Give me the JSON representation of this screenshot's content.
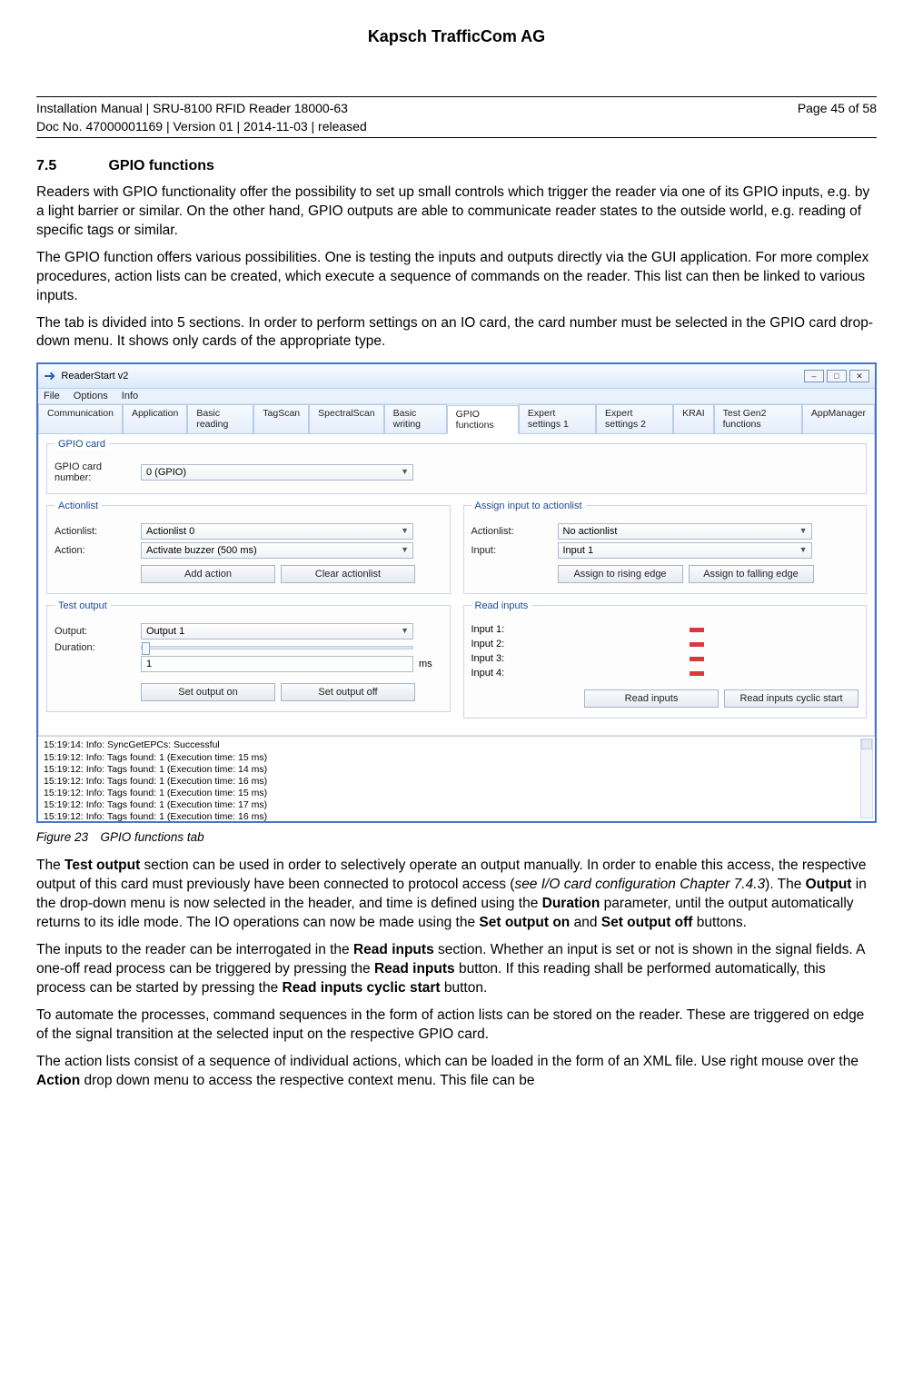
{
  "company": "Kapsch TrafficCom AG",
  "docline1_left": "Installation Manual | SRU-8100 RFID Reader 18000-63",
  "docline1_right": "Page 45 of 58",
  "docline2_left": "Doc No. 47000001169 | Version 01 | 2014-11-03 | released",
  "section": {
    "num": "7.5",
    "title": "GPIO functions"
  },
  "para1": "Readers with GPIO functionality offer the possibility to set up small controls which trigger the reader via one of its GPIO inputs, e.g. by a light barrier or similar. On the other hand, GPIO outputs are able to communicate reader states to the outside world, e.g. reading of specific tags or similar.",
  "para2": "The GPIO function offers various possibilities. One is testing the inputs and outputs directly via the GUI application. For more complex procedures, action lists can be created, which execute a sequence of commands on the reader. This list can then be linked to various inputs.",
  "para3": "The tab is divided into 5 sections. In order to perform settings on an IO card, the card number must be selected in the GPIO card drop-down menu. It shows only cards of the appropriate type.",
  "caption": "Figure 23 GPIO functions tab",
  "para4_pre": "The ",
  "para4_b1": "Test output",
  "para4_mid1": " section can be used in order to selectively operate an output manually. In order to enable this access, the respective output of this card must previously have been connected to protocol access (",
  "para4_i": "see I/O card configuration Chapter 7.4.3",
  "para4_mid2": "). The ",
  "para4_b2": "Output",
  "para4_mid3": " in the drop-down menu is now selected in the header, and time is defined using the ",
  "para4_b3": "Duration",
  "para4_mid4": " parameter, until the output automatically returns to its idle mode. The IO operations can now be made using the ",
  "para4_b4": "Set output on",
  "para4_mid5": " and ",
  "para4_b5": "Set output off",
  "para4_end": " buttons.",
  "para5_pre": "The inputs to the reader can be interrogated in the ",
  "para5_b1": "Read inputs",
  "para5_mid1": " section. Whether an input is set or not is shown in the signal fields. A one-off read process can be triggered by pressing the ",
  "para5_b2": "Read inputs",
  "para5_mid2": " button. If this reading shall be performed automatically, this process can be started by pressing the ",
  "para5_b3": "Read inputs cyclic start",
  "para5_end": " button.",
  "para6": "To automate the processes, command sequences in the form of action lists can be stored on the reader. These are triggered on edge of the signal transition at the selected input on the respective GPIO card.",
  "para7_pre": "The action lists consist of a sequence of individual actions, which can be loaded in the form of an XML file. Use right mouse over the ",
  "para7_b": "Action",
  "para7_end": " drop down menu to access the respective context menu.  This file can be",
  "win": {
    "title": "ReaderStart v2",
    "menu": {
      "file": "File",
      "options": "Options",
      "info": "Info"
    },
    "tabs": [
      "Communication",
      "Application",
      "Basic reading",
      "TagScan",
      "SpectralScan",
      "Basic writing",
      "GPIO functions",
      "Expert settings 1",
      "Expert settings 2",
      "KRAI",
      "Test Gen2 functions",
      "AppManager"
    ],
    "gpio_card": {
      "legend": "GPIO card",
      "label": "GPIO card number:",
      "value": "0 (GPIO)"
    },
    "actionlist": {
      "legend": "Actionlist",
      "list_label": "Actionlist:",
      "list_value": "Actionlist 0",
      "action_label": "Action:",
      "action_value": "Activate buzzer (500 ms)",
      "btn_add": "Add action",
      "btn_clear": "Clear actionlist"
    },
    "assign": {
      "legend": "Assign input to actionlist",
      "list_label": "Actionlist:",
      "list_value": "No actionlist",
      "input_label": "Input:",
      "input_value": "Input 1",
      "btn_rise": "Assign to rising edge",
      "btn_fall": "Assign to falling edge"
    },
    "testout": {
      "legend": "Test output",
      "out_label": "Output:",
      "out_value": "Output 1",
      "dur_label": "Duration:",
      "dur_num": "1",
      "ms": "ms",
      "btn_on": "Set output on",
      "btn_off": "Set output off"
    },
    "readin": {
      "legend": "Read inputs",
      "in1": "Input 1:",
      "in2": "Input 2:",
      "in3": "Input 3:",
      "in4": "Input 4:",
      "btn_read": "Read inputs",
      "btn_cyclic": "Read inputs cyclic start"
    },
    "log": [
      "15:19:14: Info: SyncGetEPCs: Successful",
      "15:19:12: Info: Tags found: 1 (Execution time: 15 ms)",
      "15:19:12: Info: Tags found: 1 (Execution time: 14 ms)",
      "15:19:12: Info: Tags found: 1 (Execution time: 16 ms)",
      "15:19:12: Info: Tags found: 1 (Execution time: 15 ms)",
      "15:19:12: Info: Tags found: 1 (Execution time: 17 ms)",
      "15:19:12: Info: Tags found: 1 (Execution time: 16 ms)"
    ]
  }
}
